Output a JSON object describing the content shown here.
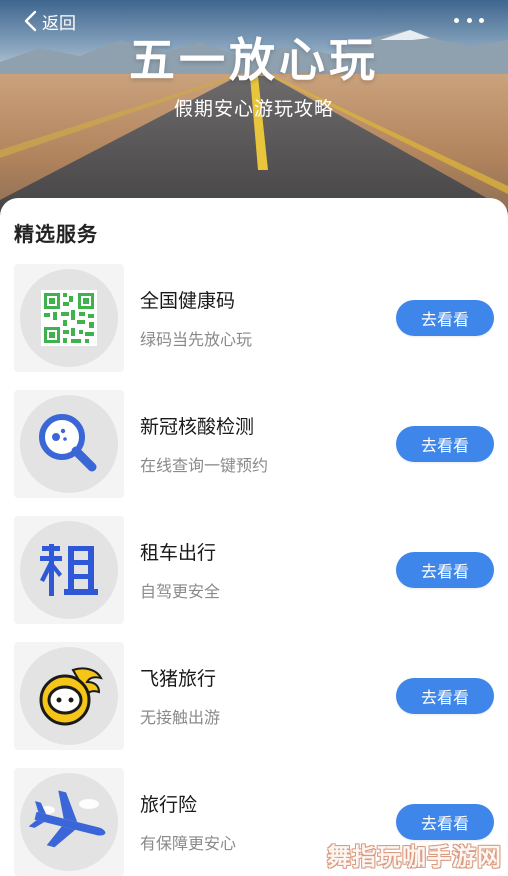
{
  "header": {
    "back_label": "返回",
    "title": "五一放心玩",
    "subtitle": "假期安心游玩攻略"
  },
  "section": {
    "title": "精选服务"
  },
  "services": [
    {
      "name": "全国健康码",
      "desc": "绿码当先放心玩",
      "button": "去看看",
      "icon": "qr-code-icon"
    },
    {
      "name": "新冠核酸检测",
      "desc": "在线查询一键预约",
      "button": "去看看",
      "icon": "magnifier-test-icon"
    },
    {
      "name": "租车出行",
      "desc": "自驾更安全",
      "button": "去看看",
      "icon": "rent-car-icon"
    },
    {
      "name": "飞猪旅行",
      "desc": "无接触出游",
      "button": "去看看",
      "icon": "fliggy-pig-icon"
    },
    {
      "name": "旅行险",
      "desc": "有保障更安心",
      "button": "去看看",
      "icon": "airplane-icon"
    }
  ],
  "watermark": "舞指玩咖手游网",
  "colors": {
    "accent": "#3f86ea",
    "qr_green": "#3fb14d",
    "rent_blue": "#2f58d6",
    "pig_yellow": "#f5c518",
    "plane_blue": "#3b66d8"
  }
}
